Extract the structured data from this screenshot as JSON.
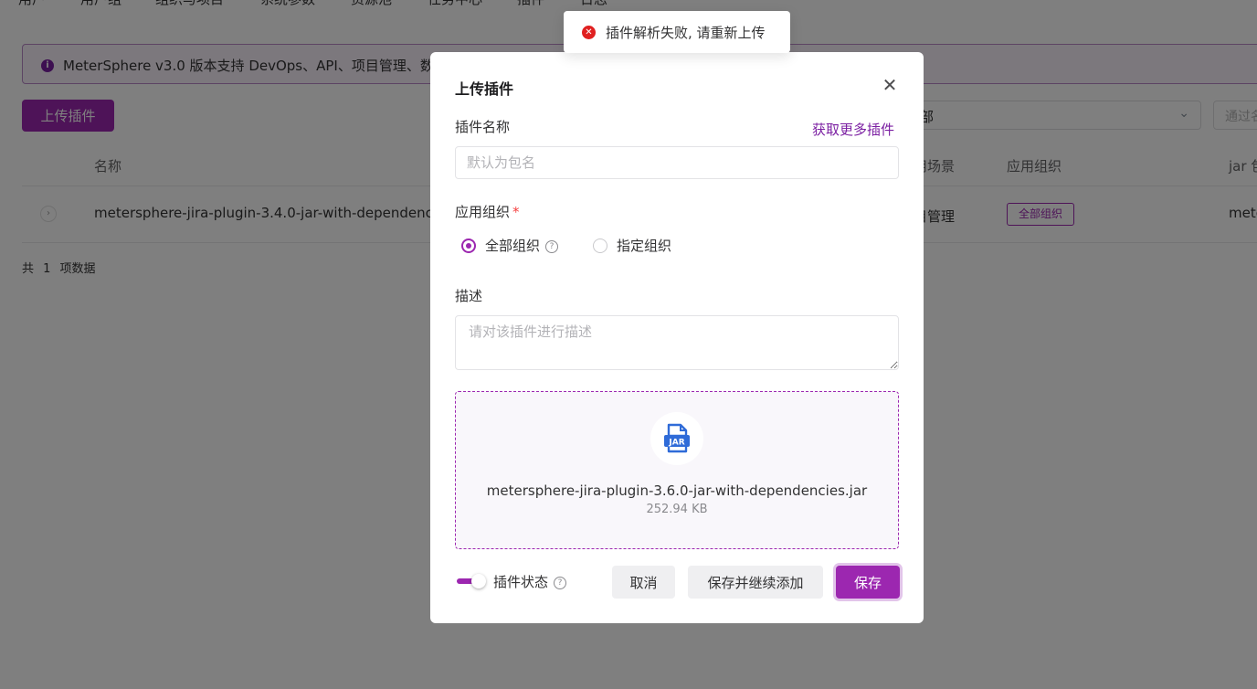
{
  "nav": {
    "items": [
      "用户",
      "用户组",
      "组织与项目",
      "系统参数",
      "资源池",
      "任务中心",
      "插件",
      "日志"
    ]
  },
  "alert": {
    "text": "MeterSphere v3.0 版本支持 DevOps、API、项目管理、数"
  },
  "toolbar": {
    "upload_label": "上传插件",
    "filter_value": "部",
    "search_placeholder": "通过名称"
  },
  "table": {
    "headers": {
      "name": "名称",
      "scene": "用场景",
      "org": "应用组织",
      "jar": "jar 包"
    },
    "row": {
      "name": "metersphere-jira-plugin-3.4.0-jar-with-dependencies.j",
      "scene": "目管理",
      "org_tag": "全部组织",
      "jar": "mete"
    },
    "total": "共 1 项数据"
  },
  "toast": {
    "message": "插件解析失败, 请重新上传",
    "status_color": "#e02020"
  },
  "modal": {
    "title": "上传插件",
    "name_label": "插件名称",
    "more_link": "获取更多插件",
    "name_placeholder": "默认为包名",
    "org_label": "应用组织",
    "required_mark": "*",
    "org_options": [
      "全部组织",
      "指定组织"
    ],
    "selected_org": "全部组织",
    "desc_label": "描述",
    "desc_placeholder": "请对该插件进行描述",
    "file": {
      "icon": "jar-file-icon",
      "icon_text": "JAR",
      "name": "metersphere-jira-plugin-3.6.0-jar-with-dependencies.jar",
      "size": "252.94 KB"
    },
    "status_label": "插件状态",
    "status_enabled": true,
    "buttons": {
      "cancel": "取消",
      "save_continue": "保存并继续添加",
      "save": "保存"
    }
  },
  "theme": {
    "accent": "#9c27b0",
    "link": "#7b1fa2"
  }
}
